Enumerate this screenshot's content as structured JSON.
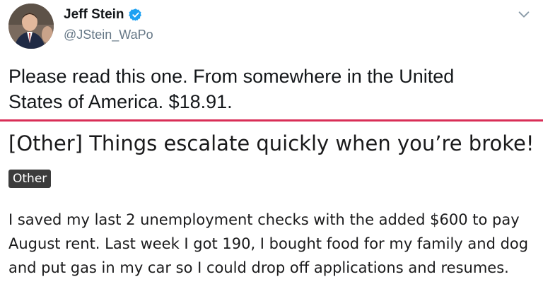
{
  "tweet": {
    "author": {
      "display_name": "Jeff Stein",
      "handle": "@JStein_WaPo",
      "verified": true
    },
    "text_lines": [
      "Please read this one. From somewhere in the United",
      "States of America. $18.91."
    ],
    "accent_color": "#d92e57",
    "verified_color": "#1da1f2"
  },
  "post": {
    "title": "[Other] Things escalate quickly when you’re broke!",
    "flair": "Other",
    "body_lines": [
      "I saved my last 2 unemployment checks with the added $600 to pay",
      "August rent. Last week I got 190, I bought food for my family and dog",
      "and put gas in my car so I could drop off applications and resumes."
    ]
  },
  "icons": {
    "menu": "chevron-down-icon",
    "verified": "verified-badge-icon"
  }
}
